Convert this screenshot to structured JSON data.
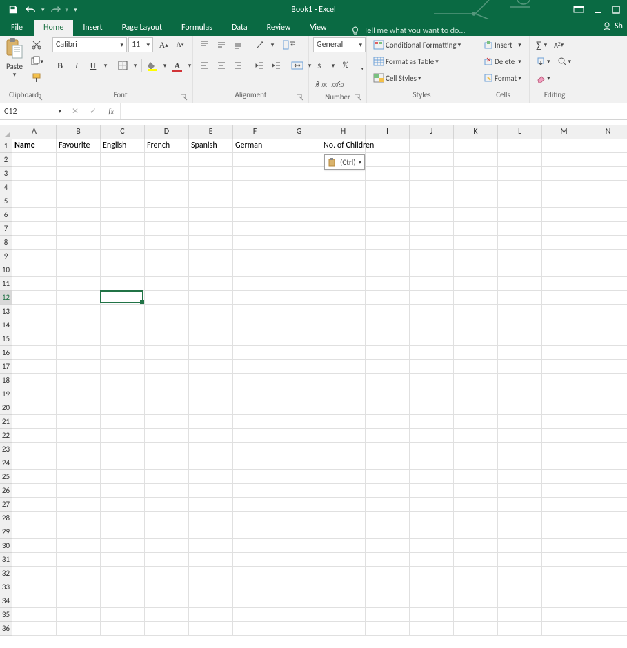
{
  "app": {
    "title": "Book1 - Excel"
  },
  "qat": {
    "save_icon": "save-icon",
    "undo_icon": "undo-icon",
    "redo_icon": "redo-icon"
  },
  "tabs": {
    "file": "File",
    "items": [
      "Home",
      "Insert",
      "Page Layout",
      "Formulas",
      "Data",
      "Review",
      "View"
    ],
    "active": "Home",
    "tell_me": "Tell me what you want to do...",
    "share": "Sh"
  },
  "ribbon": {
    "clipboard": {
      "paste": "Paste",
      "label": "Clipboard"
    },
    "font": {
      "name": "Calibri",
      "size": "11",
      "label": "Font"
    },
    "alignment": {
      "label": "Alignment"
    },
    "number": {
      "format": "General",
      "label": "Number"
    },
    "styles": {
      "cond": "Conditional Formatting",
      "table": "Format as Table",
      "cell": "Cell Styles",
      "label": "Styles"
    },
    "cells": {
      "insert": "Insert",
      "delete": "Delete",
      "format": "Format",
      "label": "Cells"
    },
    "editing": {
      "label": "Editing"
    }
  },
  "formula_bar": {
    "name_box": "C12",
    "formula": ""
  },
  "grid": {
    "columns": [
      "A",
      "B",
      "C",
      "D",
      "E",
      "F",
      "G",
      "H",
      "I",
      "J",
      "K",
      "L",
      "M",
      "N"
    ],
    "row_count": 36,
    "selected_row": 12,
    "selected_col_index": 2,
    "headers_row": {
      "A": "Name",
      "B": "Favourite",
      "C": "English",
      "D": "French",
      "E": "Spanish",
      "F": "German",
      "H": "No. of Children"
    },
    "paste_options": {
      "label": "(Ctrl)"
    }
  },
  "colors": {
    "accent": "#217346",
    "title_bg": "#0a6a43"
  }
}
